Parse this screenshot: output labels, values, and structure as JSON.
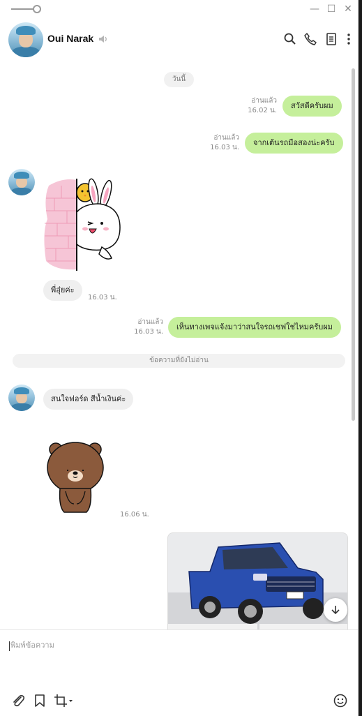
{
  "window": {
    "minimize_glyph": "—",
    "maximize_glyph": "☐",
    "close_glyph": "✕"
  },
  "header": {
    "contact_name": "Oui Narak",
    "icons": [
      "search-icon",
      "phone-icon",
      "notes-icon",
      "more-icon"
    ]
  },
  "chat": {
    "date_label": "วันนี้",
    "unread_divider": "ข้อความที่ยังไม่อ่าน",
    "messages": [
      {
        "direction": "out",
        "text": "สวัสดีครับผม",
        "read_label": "อ่านแล้ว",
        "time": "16.02 น."
      },
      {
        "direction": "out",
        "text": "จากเต้นรถมือสองน่ะครับ",
        "read_label": "อ่านแล้ว",
        "time": "16.03 น."
      },
      {
        "direction": "in",
        "type": "sticker",
        "sticker": "cony-peeking"
      },
      {
        "direction": "in",
        "text": "พี่อุ๋ยค่ะ",
        "time": "16.03 น."
      },
      {
        "direction": "out",
        "text": "เห็นทางเพจแจ้งมาว่าสนใจรถเชฟใช่ไหมครับผม",
        "read_label": "อ่านแล้ว",
        "time": "16.03 น."
      },
      {
        "direction": "in",
        "text": "สนใจฟอร์ด สีน้ำเงินค่ะ"
      },
      {
        "direction": "in",
        "type": "sticker",
        "sticker": "brown-bow",
        "time": "16.06 น."
      },
      {
        "direction": "out",
        "type": "image",
        "image": "blue-pickup-truck"
      }
    ]
  },
  "composer": {
    "placeholder": "พิมพ์ข้อความ",
    "icons": [
      "attach-icon",
      "bookmark-icon",
      "crop-icon",
      "emoji-icon"
    ]
  },
  "colors": {
    "outgoing_bubble": "#c5ef9b",
    "incoming_bubble": "#efefef"
  }
}
